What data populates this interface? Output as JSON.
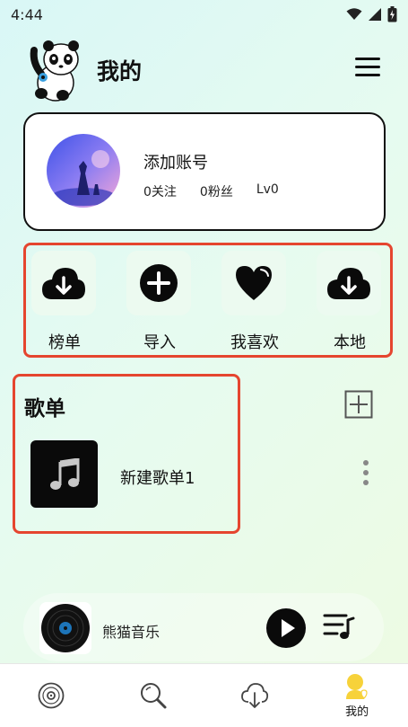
{
  "status_bar": {
    "time": "4:44"
  },
  "header": {
    "title": "我的"
  },
  "account": {
    "name": "添加账号",
    "following": "0关注",
    "followers": "0粉丝",
    "level": "Lv0"
  },
  "quick_actions": [
    {
      "label": "榜单",
      "icon": "cloud-download-icon"
    },
    {
      "label": "导入",
      "icon": "plus-circle-icon"
    },
    {
      "label": "我喜欢",
      "icon": "heart-icon"
    },
    {
      "label": "本地",
      "icon": "cloud-download-icon"
    }
  ],
  "playlists": {
    "title": "歌单",
    "items": [
      {
        "name": "新建歌单1"
      }
    ]
  },
  "player": {
    "title": "熊猫音乐"
  },
  "nav": {
    "items": [
      {
        "icon": "disc-icon"
      },
      {
        "icon": "search-icon"
      },
      {
        "icon": "cloud-download-icon"
      },
      {
        "icon": "profile-icon",
        "label": "我的"
      }
    ]
  },
  "colors": {
    "highlight_box": "#e5452f",
    "tile_bg": "#ecfaf0",
    "avatar_gradient": [
      "#4b5cf0",
      "#f39ad4"
    ]
  }
}
